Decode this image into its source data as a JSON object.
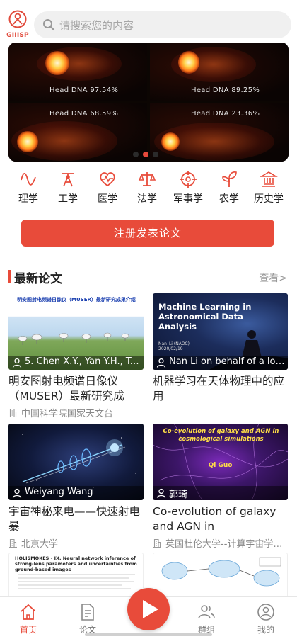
{
  "header": {
    "logo_text": "GIIISP",
    "search_placeholder": "请搜索您的内容"
  },
  "banner": {
    "panels": [
      {
        "label": "Head DNA 97.54%"
      },
      {
        "label": "Head DNA 89.25%"
      },
      {
        "label": "Head DNA 68.59%"
      },
      {
        "label": "Head DNA 23.36%"
      }
    ],
    "slide_count": 3,
    "active_slide": 2
  },
  "categories": [
    {
      "label": "理学",
      "icon": "wave-icon"
    },
    {
      "label": "工学",
      "icon": "compass-icon"
    },
    {
      "label": "医学",
      "icon": "heartbeat-icon"
    },
    {
      "label": "法学",
      "icon": "scales-icon"
    },
    {
      "label": "军事学",
      "icon": "crosshair-icon"
    },
    {
      "label": "农学",
      "icon": "sprout-icon"
    },
    {
      "label": "历史学",
      "icon": "temple-icon"
    }
  ],
  "register_button": "注册发表论文",
  "section": {
    "title": "最新论文",
    "more": "查看>"
  },
  "papers": [
    {
      "thumb_title": "明安图射电频谱日像仪（MUSER）最新研究成果介绍",
      "author": "5. Chen X.Y., Yan Y.H., Ta…",
      "title": "明安图射电频谱日像仪（MUSER）最新研究成果…",
      "source": "中国科学院国家天文台"
    },
    {
      "thumb_title": "Machine Learning in Astronomical Data Analysis",
      "thumb_sub": "Nan_Li (NAOC)",
      "thumb_date": "2020/02/19",
      "author": "Nan Li on behalf of a lot …",
      "title": "机器学习在天体物理中的应用",
      "source": ""
    },
    {
      "author": "Weiyang Wang",
      "title": "宇宙神秘来电——快速射电暴",
      "source": "北京大学"
    },
    {
      "thumb_title": "Co-evolution of galaxy and AGN in cosmological simulations",
      "thumb_author": "Qi Guo",
      "author": "郭琦",
      "title": "Co-evolution of galaxy and AGN in cosmological…",
      "source": "英国杜伦大学--计算宇宙学…"
    },
    {
      "thumb_title": "HOLISMOKES - IX. Neural network inference of strong-lens parameters and uncertainties from ground-based images"
    },
    {}
  ],
  "tabs": [
    {
      "label": "首页",
      "icon": "home-icon",
      "active": true
    },
    {
      "label": "论文",
      "icon": "document-icon",
      "active": false
    },
    {
      "label": "群组",
      "icon": "group-icon",
      "active": false
    },
    {
      "label": "我的",
      "icon": "profile-icon",
      "active": false
    }
  ],
  "colors": {
    "accent": "#e84b3a",
    "muted": "#999999"
  }
}
